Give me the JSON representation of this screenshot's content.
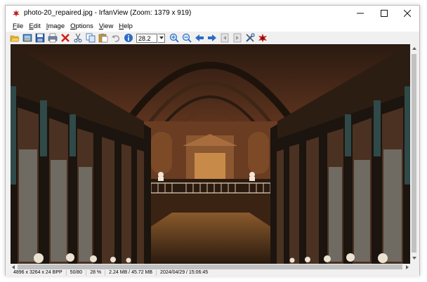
{
  "window": {
    "title": "photo-20_repaired.jpg - IrfanView (Zoom: 1379 x 919)"
  },
  "menu": [
    {
      "u": "F",
      "rest": "ile"
    },
    {
      "u": "E",
      "rest": "dit"
    },
    {
      "u": "I",
      "rest": "mage"
    },
    {
      "u": "O",
      "rest": "ptions"
    },
    {
      "u": "V",
      "rest": "iew"
    },
    {
      "u": "H",
      "rest": "elp"
    }
  ],
  "toolbar": {
    "zoom_value": "28.2"
  },
  "status": {
    "dimensions": "4896 x 3264 x 24 BPP",
    "index": "50/80",
    "zoom": "28 %",
    "size": "2.24 MB / 45.72 MB",
    "datetime": "2024/04/29 / 15:06:45"
  },
  "colors": {
    "accent_blue": "#2b6cc4",
    "close_red": "#cc1f1f",
    "image_warm": "#6b3a22",
    "bookshelf_dark": "#1c140e"
  },
  "icons": [
    "app-icon",
    "open-icon",
    "slideshow-icon",
    "save-icon",
    "print-icon",
    "delete-icon",
    "cut-icon",
    "copy-icon",
    "paste-icon",
    "undo-icon",
    "info-icon",
    "zoom-in-icon",
    "zoom-out-icon",
    "previous-icon",
    "next-icon",
    "first-page-icon",
    "last-page-icon",
    "settings-icon",
    "irfanview-icon"
  ]
}
